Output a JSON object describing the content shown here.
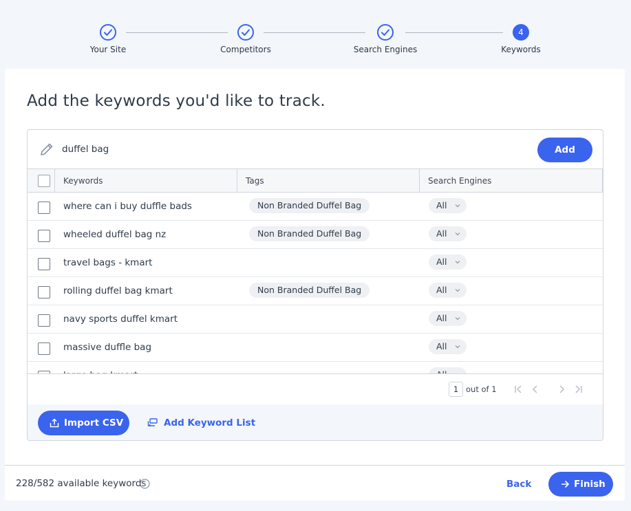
{
  "stepper": {
    "steps": [
      {
        "label": "Your Site",
        "state": "done"
      },
      {
        "label": "Competitors",
        "state": "done"
      },
      {
        "label": "Search Engines",
        "state": "done"
      },
      {
        "label": "Keywords",
        "state": "current",
        "number": "4"
      }
    ]
  },
  "card": {
    "title": "Add the keywords you'd like to track."
  },
  "input": {
    "value": "duffel bag",
    "add_label": "Add"
  },
  "table": {
    "headers": {
      "keywords": "Keywords",
      "tags": "Tags",
      "search_engines": "Search Engines"
    },
    "rows": [
      {
        "keyword": "where can i buy duffle bads",
        "tag": "Non Branded Duffel Bag",
        "engine": "All"
      },
      {
        "keyword": "wheeled duffel bag nz",
        "tag": "Non Branded Duffel Bag",
        "engine": "All"
      },
      {
        "keyword": "travel bags - kmart",
        "tag": "",
        "engine": "All"
      },
      {
        "keyword": "rolling duffel bag kmart",
        "tag": "Non Branded Duffel Bag",
        "engine": "All"
      },
      {
        "keyword": "navy sports duffel kmart",
        "tag": "",
        "engine": "All"
      },
      {
        "keyword": "massive duffle bag",
        "tag": "",
        "engine": "All"
      },
      {
        "keyword": "large bag kmart",
        "tag": "",
        "engine": "All"
      }
    ]
  },
  "pager": {
    "page": "1",
    "out_of": "out of 1"
  },
  "panel_footer": {
    "import_label": "Import CSV",
    "list_label": "Add Keyword List"
  },
  "footer": {
    "available": "228/582 available keywords",
    "back_label": "Back",
    "finish_label": "Finish"
  },
  "colors": {
    "accent": "#3a63ee",
    "background": "#f3f6fa"
  }
}
